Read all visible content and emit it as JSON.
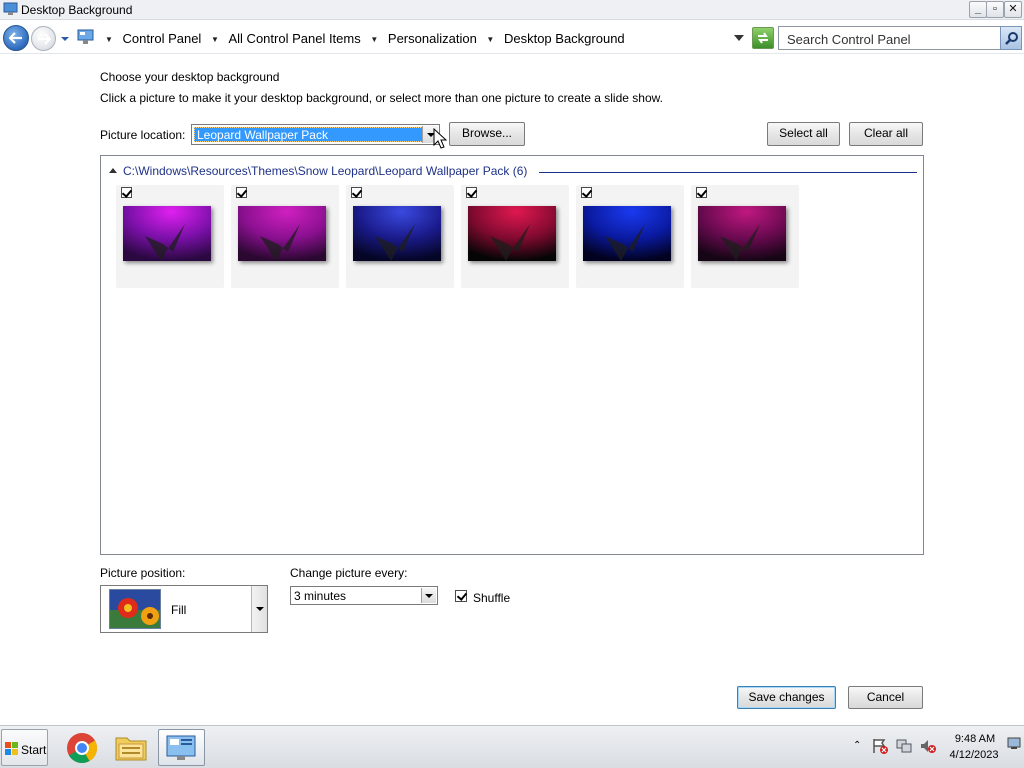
{
  "window": {
    "title": "Desktop Background",
    "controls": {
      "minimize": "_",
      "maximize": "▫",
      "close": "✕"
    }
  },
  "navbar": {
    "breadcrumbs": [
      "Control Panel",
      "All Control Panel Items",
      "Personalization",
      "Desktop Background"
    ],
    "search_placeholder": "Search Control Panel"
  },
  "main": {
    "heading": "Choose your desktop background",
    "subheading": "Click a picture to make it your desktop background, or select more than one picture to create a slide show.",
    "picture_location_label": "Picture location:",
    "picture_location_value": "Leopard Wallpaper Pack",
    "browse_label": "Browse...",
    "select_all_label": "Select all",
    "clear_all_label": "Clear all",
    "group_path": "C:\\Windows\\Resources\\Themes\\Snow Leopard\\Leopard Wallpaper Pack (6)",
    "wallpapers": [
      {
        "checked": true,
        "colors": [
          "#e020f0",
          "#7a10a8",
          "#2a0840"
        ]
      },
      {
        "checked": true,
        "colors": [
          "#d020c0",
          "#8a1090",
          "#2a0830"
        ]
      },
      {
        "checked": true,
        "colors": [
          "#3a4ae0",
          "#1a1a8a",
          "#050525"
        ]
      },
      {
        "checked": true,
        "colors": [
          "#e01850",
          "#800a30",
          "#050505"
        ]
      },
      {
        "checked": true,
        "colors": [
          "#1a3af0",
          "#0a1aa0",
          "#020220"
        ]
      },
      {
        "checked": true,
        "colors": [
          "#c01880",
          "#6a0a50",
          "#150515"
        ]
      }
    ],
    "picture_position_label": "Picture position:",
    "picture_position_value": "Fill",
    "change_every_label": "Change picture every:",
    "change_every_value": "3 minutes",
    "shuffle_label": "Shuffle",
    "shuffle_checked": true,
    "save_label": "Save changes",
    "cancel_label": "Cancel"
  },
  "taskbar": {
    "start_label": "Start",
    "apps": [
      "chrome-icon",
      "explorer-folder-icon",
      "control-panel-icon"
    ],
    "clock_time": "9:48 AM",
    "clock_date": "4/12/2023"
  },
  "colors": {
    "accent": "#3399ff",
    "group_header": "#1e3287"
  }
}
